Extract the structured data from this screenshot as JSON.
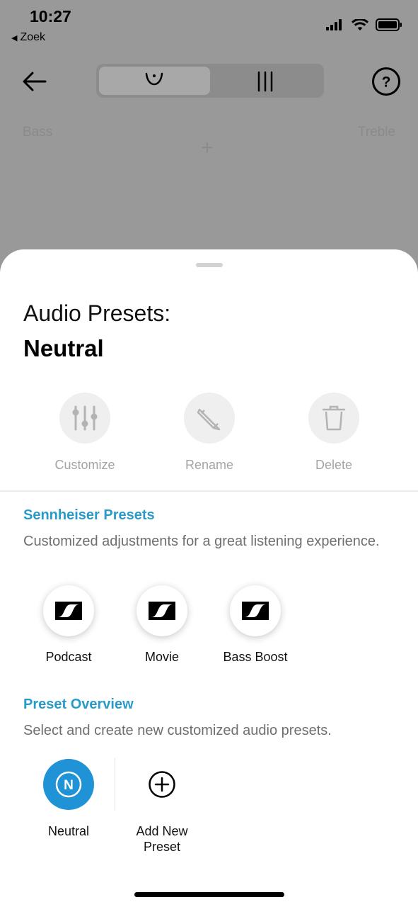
{
  "status_bar": {
    "time": "10:27",
    "back_app": "Zoek",
    "icons": [
      "cellular-signal-icon",
      "wifi-icon",
      "battery-icon"
    ]
  },
  "nav": {
    "back_icon": "arrow-left-icon",
    "segments": [
      {
        "icon": "curve-eq-icon",
        "selected": true
      },
      {
        "icon": "bars-eq-icon",
        "selected": false
      }
    ],
    "help_icon": "question-circle-icon"
  },
  "equalizer": {
    "left_label": "Bass",
    "right_label": "Treble",
    "plus": "+"
  },
  "sheet": {
    "title": "Audio Presets:",
    "current_preset": "Neutral",
    "actions": [
      {
        "label": "Customize",
        "icon": "sliders-icon"
      },
      {
        "label": "Rename",
        "icon": "pencil-icon"
      },
      {
        "label": "Delete",
        "icon": "trash-icon"
      }
    ],
    "sennheiser": {
      "title": "Sennheiser Presets",
      "description": "Customized adjustments for a great listening experience.",
      "presets": [
        {
          "label": "Podcast",
          "icon": "sennheiser-logo-icon"
        },
        {
          "label": "Movie",
          "icon": "sennheiser-logo-icon"
        },
        {
          "label": "Bass Boost",
          "icon": "sennheiser-logo-icon"
        }
      ]
    },
    "overview": {
      "title": "Preset Overview",
      "description": "Select and create new customized audio presets.",
      "items": [
        {
          "label": "Neutral",
          "badge": "N",
          "selected": true
        },
        {
          "label": "Add New Preset",
          "icon": "plus-circle-icon"
        }
      ]
    }
  },
  "colors": {
    "accent": "#2a9bc8",
    "selected_preset": "#1f93d6",
    "overlay": "#999999"
  }
}
